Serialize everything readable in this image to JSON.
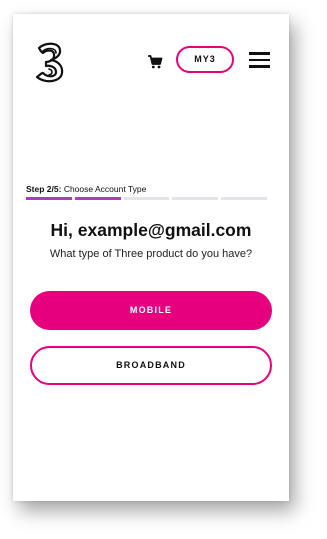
{
  "header": {
    "logo_icon": "three-logo-icon",
    "cart_icon": "shopping-cart-icon",
    "my3_label": "MY3",
    "menu_icon": "hamburger-menu-icon"
  },
  "step": {
    "prefix": "Step 2/5:",
    "title": "Choose Account Type",
    "current": 2,
    "total": 5
  },
  "main": {
    "greeting": "Hi, example@gmail.com",
    "question": "What type of Three product do you have?",
    "options": [
      {
        "label": "MOBILE"
      },
      {
        "label": "BROADBAND"
      }
    ]
  },
  "colors": {
    "accent": "#e6007e",
    "progress_done": "#a63cc8",
    "progress_todo": "#e4e2ea"
  }
}
